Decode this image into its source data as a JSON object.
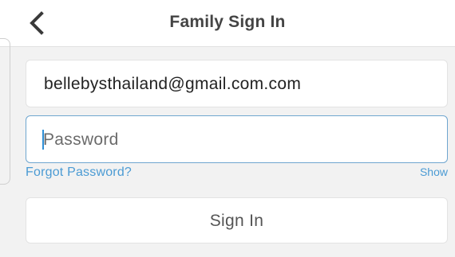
{
  "header": {
    "title": "Family Sign In",
    "back_icon": "chevron-left-icon"
  },
  "form": {
    "email_value": "bellebysthailand@gmail.com.com",
    "password_placeholder": "Password",
    "forgot_password_label": "Forgot Password?",
    "show_label": "Show",
    "sign_in_label": "Sign In"
  },
  "colors": {
    "link": "#4b9bd4",
    "focus_border": "#6fa6cf",
    "title_text": "#444444",
    "background": "#f2f2f2"
  }
}
